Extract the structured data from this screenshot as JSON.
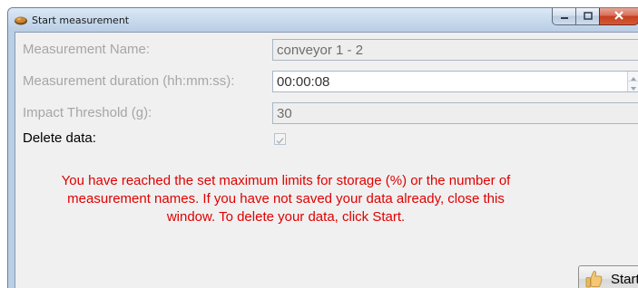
{
  "window": {
    "title": "Start measurement",
    "icons": {
      "app": "tape-measure-icon",
      "minimize": "minimize-icon",
      "maximize": "maximize-icon",
      "close": "close-icon"
    }
  },
  "form": {
    "measurement_name": {
      "label": "Measurement Name:",
      "value": "conveyor 1 - 2"
    },
    "duration": {
      "label": "Measurement duration (hh:mm:ss):",
      "value": "00:00:08"
    },
    "impact_threshold": {
      "label": "Impact Threshold (g):",
      "value": "30"
    },
    "delete_data": {
      "label": "Delete data:",
      "checked": true
    }
  },
  "message": {
    "line1": "You have reached the set maximum limits for storage (%) or the number of",
    "line2": "measurement names. If you have not saved your data already, close this",
    "line3": "window. To delete your data, click Start."
  },
  "start_button": {
    "label": "Start",
    "icon": "thumbs-up-icon"
  },
  "colors": {
    "message": "#e00000",
    "disabled_text": "#a6a6a6",
    "client_background": "#f0f0f0",
    "titlebar": "#c7d9ec"
  }
}
